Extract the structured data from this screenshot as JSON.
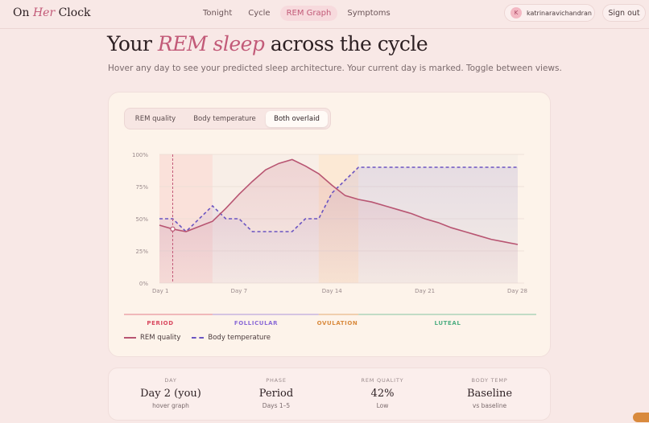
{
  "brand": {
    "pre": "On ",
    "accent": "Her",
    "post": " Clock"
  },
  "nav": {
    "items": [
      {
        "label": "Tonight"
      },
      {
        "label": "Cycle"
      },
      {
        "label": "REM Graph"
      },
      {
        "label": "Symptoms"
      }
    ],
    "active": "REM Graph"
  },
  "user": {
    "initial": "K",
    "name": "katrinaravichandran"
  },
  "signout_label": "Sign out",
  "header": {
    "title_pre": "Your ",
    "title_accent": "REM sleep",
    "title_post": " across the cycle",
    "subtitle": "Hover any day to see your predicted sleep architecture. Your current day is marked. Toggle between views."
  },
  "toggle": {
    "options": [
      "REM quality",
      "Body temperature",
      "Both overlaid"
    ],
    "selected": "Both overlaid"
  },
  "chart_data": {
    "type": "line",
    "x": [
      1,
      2,
      3,
      4,
      5,
      6,
      7,
      8,
      9,
      10,
      11,
      12,
      13,
      14,
      15,
      16,
      17,
      18,
      19,
      20,
      21,
      22,
      23,
      24,
      25,
      26,
      27,
      28
    ],
    "series": [
      {
        "name": "REM quality",
        "values": [
          45,
          42,
          40,
          44,
          48,
          58,
          69,
          79,
          88,
          93,
          96,
          91,
          85,
          76,
          68,
          65,
          63,
          60,
          57,
          54,
          50,
          47,
          43,
          40,
          37,
          34,
          32,
          30
        ],
        "color": "#b85572"
      },
      {
        "name": "Body temperature",
        "values": [
          50,
          50,
          40,
          50,
          60,
          50,
          50,
          40,
          40,
          40,
          40,
          50,
          50,
          70,
          80,
          90,
          90,
          90,
          90,
          90,
          90,
          90,
          90,
          90,
          90,
          90,
          90,
          90
        ],
        "color": "#6b55c2"
      }
    ],
    "x_ticks": [
      "Day 1",
      "Day 7",
      "Day 14",
      "Day 21",
      "Day 28"
    ],
    "y_ticks": [
      "0%",
      "25%",
      "50%",
      "75%",
      "100%"
    ],
    "ylim": [
      0,
      100
    ],
    "xlim": [
      1,
      28
    ],
    "current_day": 2,
    "grid": true,
    "phases": [
      {
        "name": "PERIOD",
        "start": 1,
        "end": 5,
        "color": "#d9485f"
      },
      {
        "name": "FOLLICULAR",
        "start": 5,
        "end": 13,
        "color": "#8a6ad6"
      },
      {
        "name": "OVULATION",
        "start": 13,
        "end": 16,
        "color": "#d98a3d"
      },
      {
        "name": "LUTEAL",
        "start": 16,
        "end": 28,
        "color": "#4fae82"
      }
    ]
  },
  "legend": {
    "rem": "REM quality",
    "temp": "Body temperature"
  },
  "stats": [
    {
      "label": "DAY",
      "value": "Day 2 (you)",
      "sub": "hover graph"
    },
    {
      "label": "PHASE",
      "value": "Period",
      "sub": "Days 1–5"
    },
    {
      "label": "REM QUALITY",
      "value": "42%",
      "sub": "Low"
    },
    {
      "label": "BODY TEMP",
      "value": "Baseline",
      "sub": "vs baseline"
    }
  ]
}
